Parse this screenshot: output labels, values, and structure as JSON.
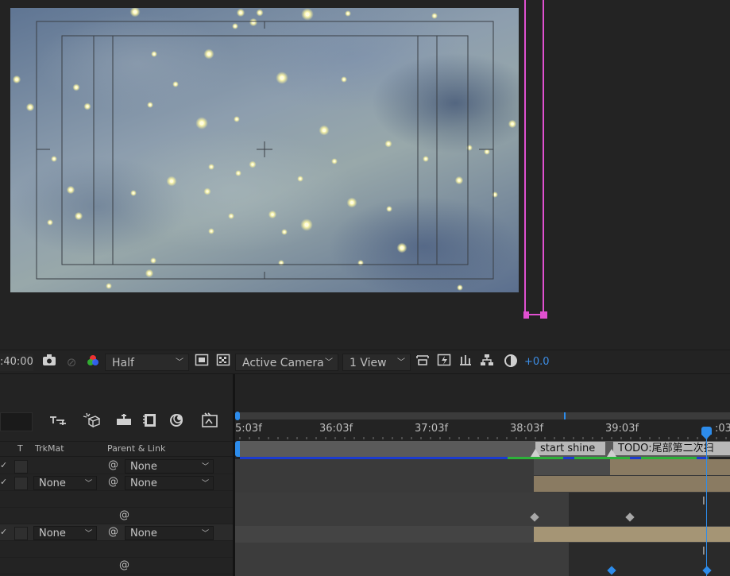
{
  "viewer": {
    "timecode": ":40:00",
    "resolution": "Half",
    "camera": "Active Camera",
    "views": "1 View",
    "exposure": "+0.0",
    "icons": [
      "camera-icon",
      "snapshot-icon",
      "color-channels-icon",
      "region-icon",
      "transparency-grid-icon",
      "reset-view-icon",
      "fast-preview-icon",
      "timeline-icon",
      "flowchart-icon",
      "exposure-icon"
    ]
  },
  "timeline": {
    "columns": {
      "t": "T",
      "trkmat": "TrkMat",
      "parent": "Parent & Link"
    },
    "toolbar_icons": [
      "draft-3d-icon",
      "shy-icon",
      "frame-blending-icon",
      "motion-blur-icon",
      "graph-editor-icon",
      "comp-marker-icon"
    ],
    "rows": [
      {
        "trkmat": "",
        "parent": "None"
      },
      {
        "trkmat": "None",
        "parent": "None"
      },
      {
        "trkmat": "",
        "parent": ""
      },
      {
        "trkmat": "",
        "parent": ""
      },
      {
        "trkmat": "None",
        "parent": "None"
      },
      {
        "trkmat": "",
        "parent": ""
      },
      {
        "trkmat": "",
        "parent": ""
      }
    ],
    "ruler": [
      "5:03f",
      "36:03f",
      "37:03f",
      "38:03f",
      "39:03f",
      ":03"
    ],
    "markers": [
      "start shine",
      "TODO:尾部第二次扫"
    ],
    "colors": {
      "playhead": "#2d8ceb",
      "work_area": "#1b3bd1",
      "layer_bar": "#8a7b62",
      "mask": "#e040c8"
    }
  }
}
